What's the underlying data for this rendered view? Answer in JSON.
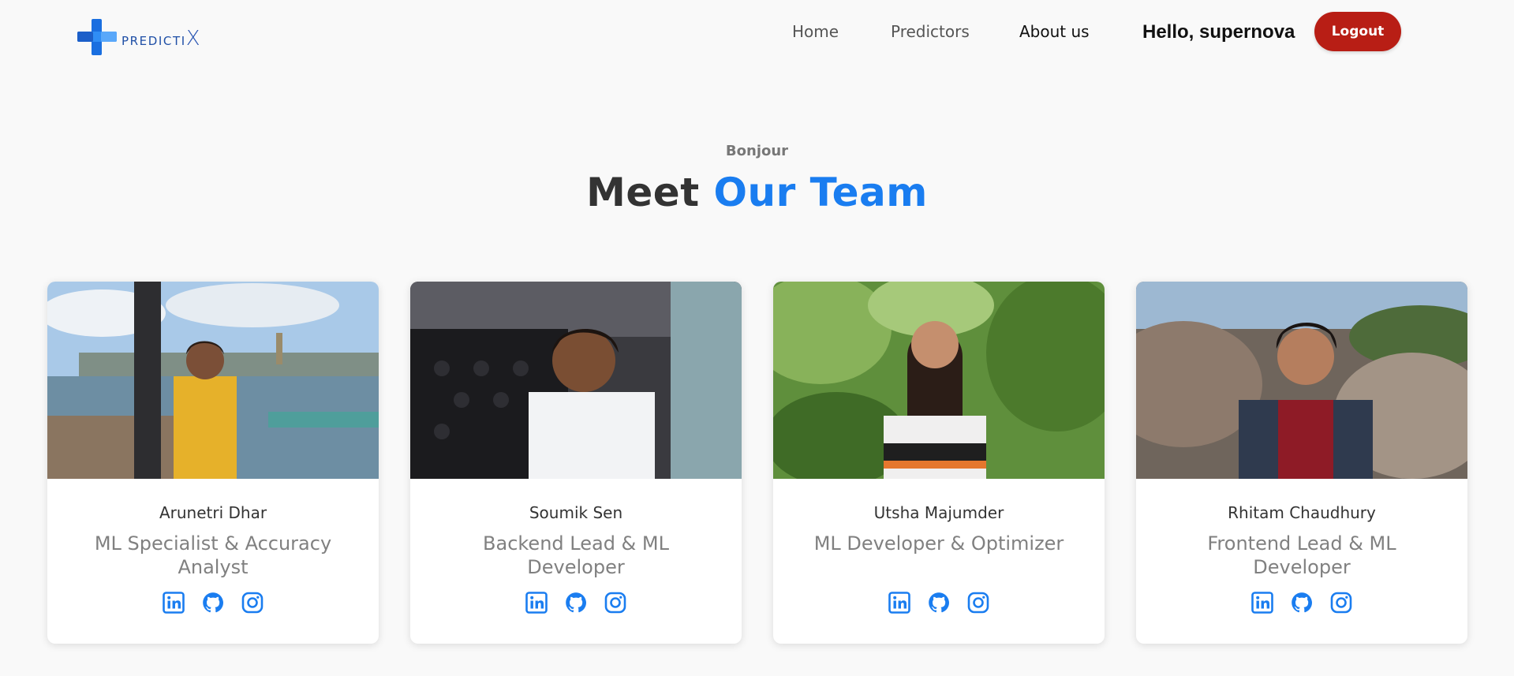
{
  "brand": {
    "name_prefix": "PREDICTI",
    "name_suffix": "X",
    "icon": "predictix-logo"
  },
  "nav": {
    "items": [
      {
        "label": "Home",
        "active": false
      },
      {
        "label": "Predictors",
        "active": false
      },
      {
        "label": "About us",
        "active": true
      }
    ],
    "greeting": "Hello, supernova",
    "logout_label": "Logout"
  },
  "section": {
    "eyebrow": "Bonjour",
    "title_main": "Meet ",
    "title_accent": "Our Team"
  },
  "team": [
    {
      "name": "Arunetri Dhar",
      "role": "ML Specialist & Accuracy Analyst",
      "photo": "person-photo"
    },
    {
      "name": "Soumik Sen",
      "role": "Backend Lead & ML Developer",
      "photo": "person-photo"
    },
    {
      "name": "Utsha Majumder",
      "role": "ML Developer & Optimizer",
      "photo": "person-photo"
    },
    {
      "name": "Rhitam Chaudhury",
      "role": "Frontend Lead & ML Developer",
      "photo": "person-photo"
    }
  ],
  "social_icons": [
    "linkedin-icon",
    "github-icon",
    "instagram-icon"
  ],
  "colors": {
    "accent": "#1a7df0",
    "logout": "#b81e15",
    "background": "#f9f9f9",
    "role_text": "#808080"
  }
}
